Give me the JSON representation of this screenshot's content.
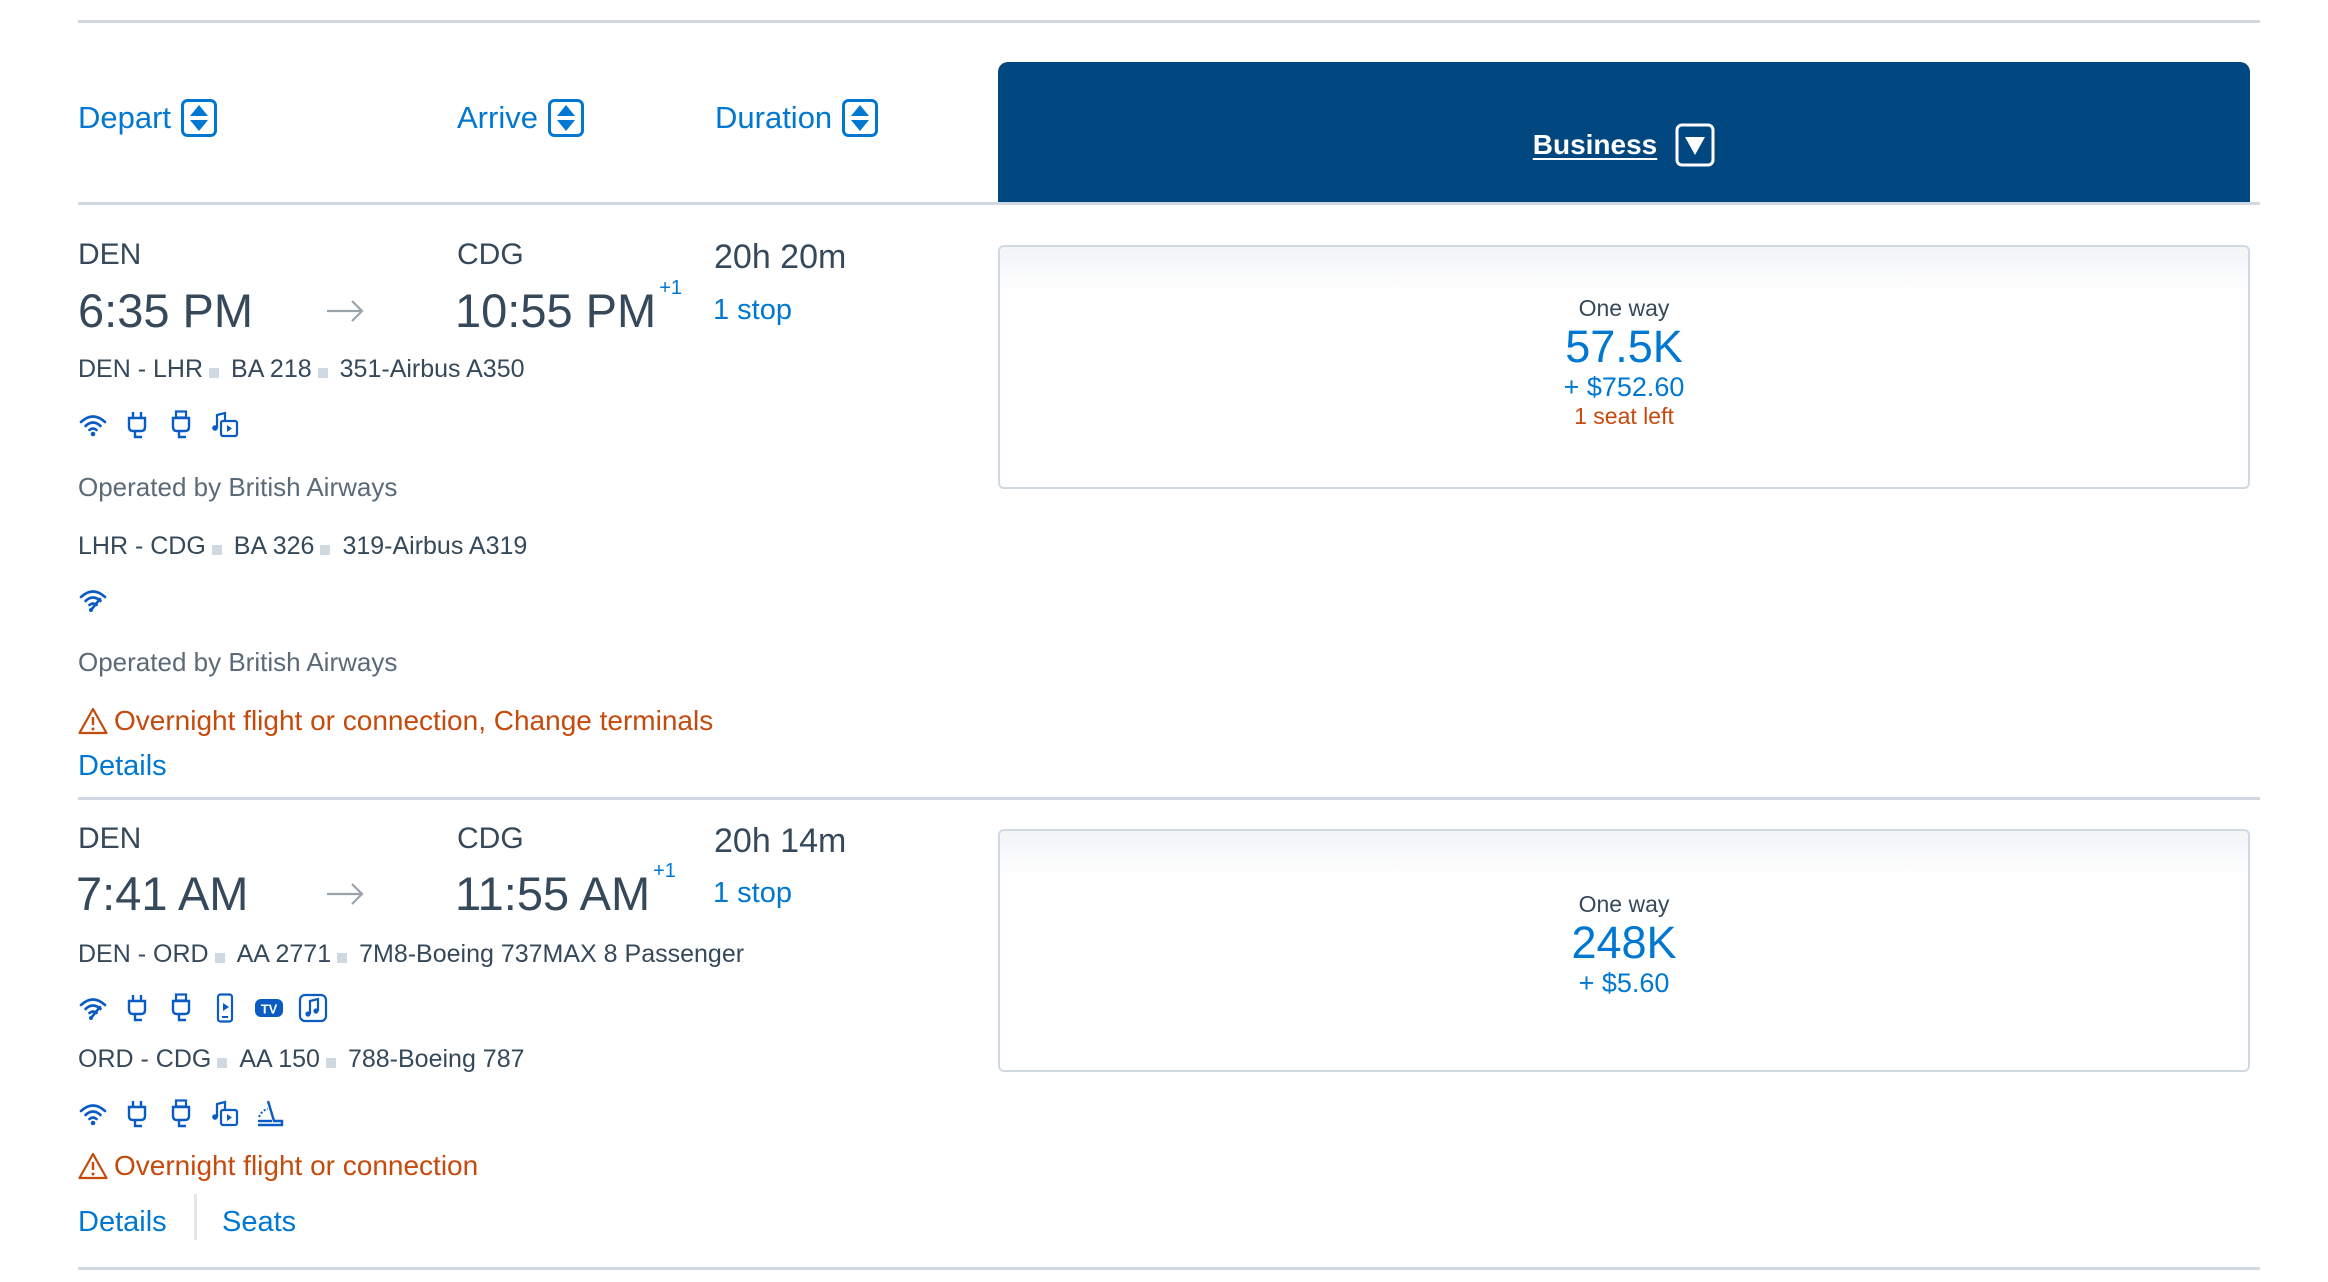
{
  "header": {
    "columns": [
      {
        "label": "Depart",
        "icon": "sort-icon"
      },
      {
        "label": "Arrive",
        "icon": "sort-icon"
      },
      {
        "label": "Duration",
        "icon": "sort-icon"
      }
    ],
    "cabin": {
      "label": "Business",
      "icon": "dropdown-icon"
    }
  },
  "colors": {
    "brand_navy": "#00467f",
    "link_blue": "#0078d2",
    "text": "#36495a",
    "warning": "#c54a0c",
    "divider": "#d0d9e2"
  },
  "flights": [
    {
      "origin": "DEN",
      "destination": "CDG",
      "depart_time": "6:35 PM",
      "arrive_time": "10:55 PM",
      "day_offset": "+1",
      "duration": "20h 20m",
      "stops": "1 stop",
      "segments": [
        {
          "route": "DEN - LHR",
          "flight_number": "BA 218",
          "aircraft": "351-Airbus A350",
          "amenities": [
            "wifi-icon",
            "power-outlet-icon",
            "usb-icon",
            "entertainment-icon"
          ],
          "operated_by": "Operated by British Airways"
        },
        {
          "route": "LHR - CDG",
          "flight_number": "BA 326",
          "aircraft": "319-Airbus A319",
          "amenities": [
            "high-speed-wifi-icon"
          ],
          "operated_by": "Operated by British Airways"
        }
      ],
      "warning": "Overnight flight or connection, Change terminals",
      "links": [
        "Details"
      ],
      "price": {
        "label": "One way",
        "miles": "57.5K",
        "taxes": "+ $752.60",
        "seats_left": "1 seat left"
      }
    },
    {
      "origin": "DEN",
      "destination": "CDG",
      "depart_time": "7:41 AM",
      "arrive_time": "11:55 AM",
      "day_offset": "+1",
      "duration": "20h 14m",
      "stops": "1 stop",
      "segments": [
        {
          "route": "DEN - ORD",
          "flight_number": "AA 2771",
          "aircraft": "7M8-Boeing 737MAX 8 Passenger",
          "amenities": [
            "high-speed-wifi-icon",
            "power-outlet-icon",
            "usb-icon",
            "device-streaming-icon",
            "live-tv-icon",
            "music-icon"
          ]
        },
        {
          "route": "ORD - CDG",
          "flight_number": "AA 150",
          "aircraft": "788-Boeing 787",
          "amenities": [
            "wifi-icon",
            "power-outlet-icon",
            "usb-icon",
            "entertainment-icon",
            "lie-flat-seat-icon"
          ]
        }
      ],
      "warning": "Overnight flight or connection",
      "links": [
        "Details",
        "Seats"
      ],
      "price": {
        "label": "One way",
        "miles": "248K",
        "taxes": "+ $5.60",
        "seats_left": ""
      }
    }
  ]
}
